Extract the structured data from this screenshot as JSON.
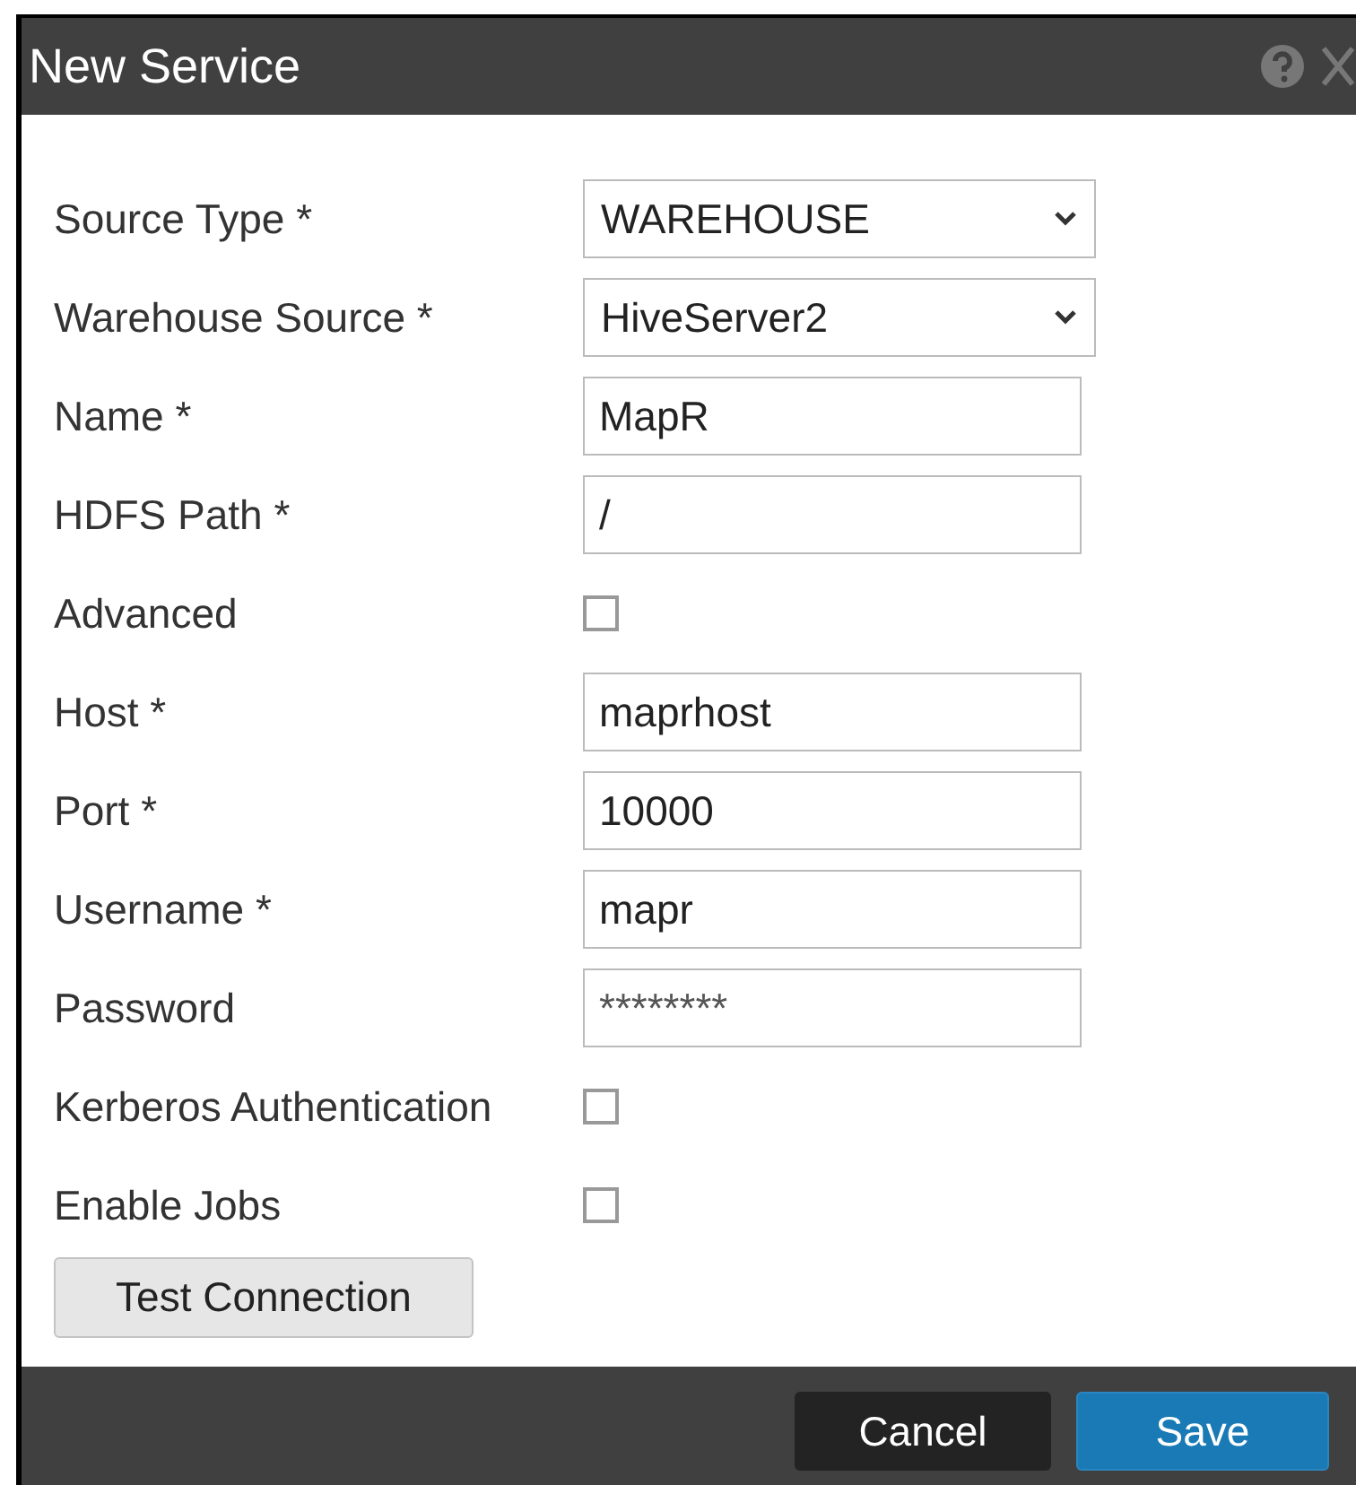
{
  "window": {
    "title": "New Service"
  },
  "fields": [
    {
      "label": "Source Type *",
      "kind": "select",
      "value": "WAREHOUSE"
    },
    {
      "label": "Warehouse Source *",
      "kind": "select",
      "value": "HiveServer2"
    },
    {
      "label": "Name *",
      "kind": "text",
      "value": "MapR"
    },
    {
      "label": "HDFS Path *",
      "kind": "text",
      "value": "/"
    },
    {
      "label": "Advanced",
      "kind": "checkbox",
      "checked": false
    },
    {
      "label": "Host *",
      "kind": "text",
      "value": "maprhost"
    },
    {
      "label": "Port *",
      "kind": "text",
      "value": "10000"
    },
    {
      "label": "Username *",
      "kind": "text",
      "value": "mapr"
    },
    {
      "label": "Password",
      "kind": "password",
      "value": "********"
    },
    {
      "label": "Kerberos Authentication",
      "kind": "checkbox",
      "checked": false
    },
    {
      "label": "Enable Jobs",
      "kind": "checkbox",
      "checked": false
    }
  ],
  "test_button": "Test Connection",
  "footer_buttons": [
    {
      "label": "Cancel",
      "kind": "secondary"
    },
    {
      "label": "Save",
      "kind": "primary"
    }
  ]
}
